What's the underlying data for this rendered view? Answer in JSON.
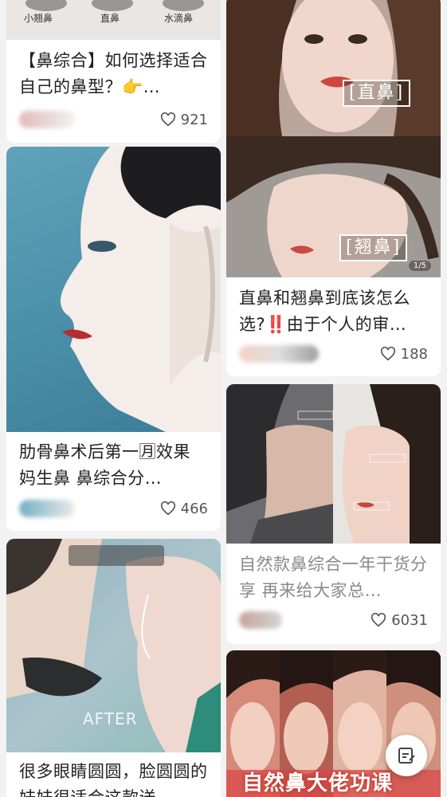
{
  "feed": {
    "left": [
      {
        "labels": [
          "小翘鼻",
          "直鼻",
          "水滴鼻"
        ],
        "title": "【鼻综合】如何选择适合自己的鼻型？👉…",
        "likes": "921"
      },
      {
        "title": "肋骨鼻术后第一🈷效果 妈生鼻 鼻综合分…",
        "likes": "466"
      },
      {
        "overlay_text": "AFTER",
        "title": "很多眼睛圆圆，脸圆圆的妹妹很适合这款送…"
      }
    ],
    "right": [
      {
        "tags": [
          "[直鼻]",
          "[翘鼻]"
        ],
        "page_indicator": "1/5",
        "title": "直鼻和翘鼻到底该怎么选?‼️由于个人的审…",
        "likes": "188"
      },
      {
        "title": "自然款鼻综合一年干货分享 再来给大家总…",
        "likes": "6031"
      },
      {
        "overlay_text": "自然鼻大佬功课"
      }
    ]
  },
  "colors": {
    "background": "#f2f2f2",
    "card": "#ffffff",
    "title": "#222222",
    "muted": "#8a8a8a"
  }
}
